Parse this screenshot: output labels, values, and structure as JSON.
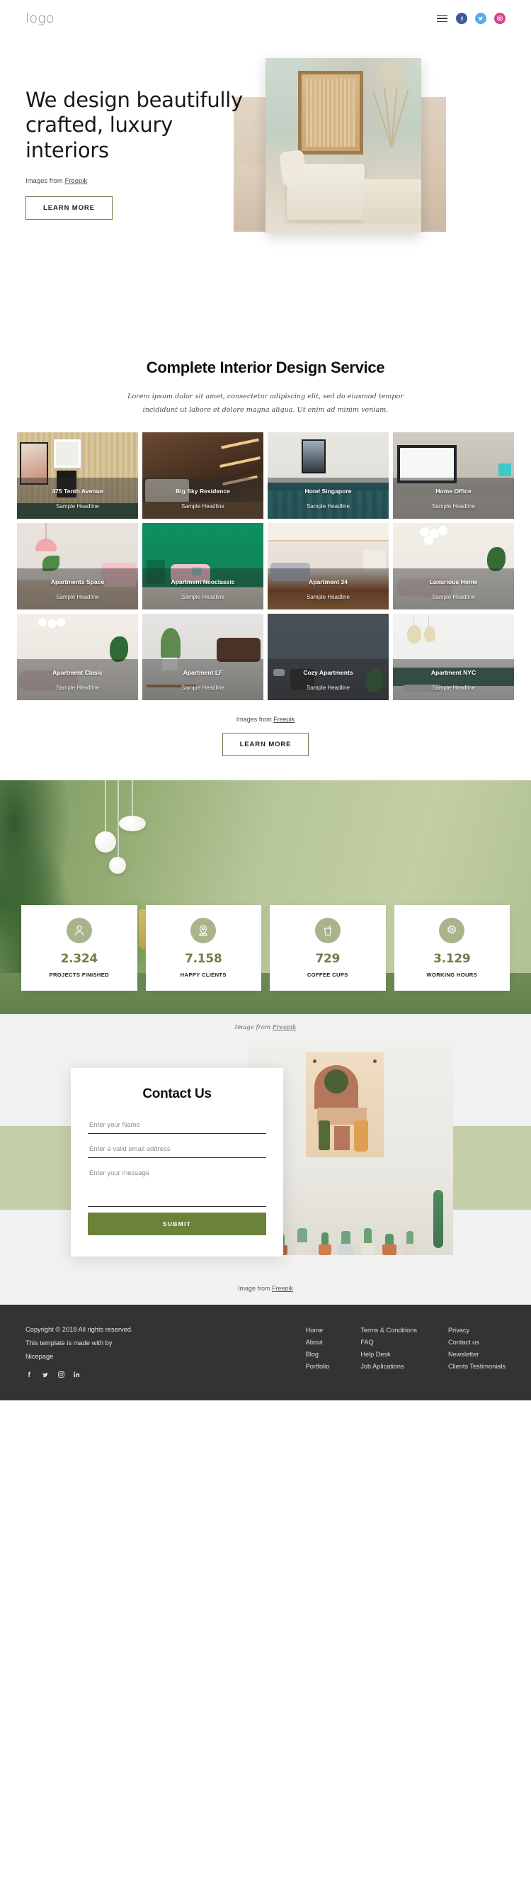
{
  "header": {
    "logo": "logo",
    "menu_icon": "hamburger-icon",
    "social": [
      {
        "name": "facebook-icon",
        "label": "f"
      },
      {
        "name": "twitter-icon",
        "label": "t"
      },
      {
        "name": "instagram-icon",
        "label": "i"
      }
    ]
  },
  "hero": {
    "title": "We design beautifully crafted, luxury interiors",
    "credit_prefix": "Images from ",
    "credit_link": "Freepik",
    "cta": "LEARN MORE"
  },
  "service": {
    "title": "Complete Interior Design Service",
    "subtitle": "Lorem ipsum dolor sit amet, consectetur adipiscing elit, sed do eiusmod tempor incididunt ut labore et dolore magna aliqua. Ut enim ad minim veniam.",
    "credit_prefix": "Images from ",
    "credit_link": "Freepik",
    "cta": "LEARN MORE",
    "cards": [
      {
        "title": "475 Tenth Avenue",
        "sub": "Sample Headline"
      },
      {
        "title": "Big Sky Residence",
        "sub": "Sample Headline"
      },
      {
        "title": "Hotel Singapore",
        "sub": "Sample Headline"
      },
      {
        "title": "Home Office",
        "sub": "Sample Headline"
      },
      {
        "title": "Apartments Space",
        "sub": "Sample Headline"
      },
      {
        "title": "Apartment Neoclassic",
        "sub": "Sample Headline"
      },
      {
        "title": "Apartment 34",
        "sub": "Sample Headline"
      },
      {
        "title": "Luxurious Home",
        "sub": "Sample Headline"
      },
      {
        "title": "Apartment Clasic",
        "sub": "Sample Headline"
      },
      {
        "title": "Apartment LF",
        "sub": "Sample Headline"
      },
      {
        "title": "Cozy Apartments",
        "sub": "Sample Headline"
      },
      {
        "title": "Apartment NYC",
        "sub": "Sample Headline"
      }
    ]
  },
  "stats": {
    "items": [
      {
        "icon": "user-icon",
        "value": "2.324",
        "label": "PROJECTS FINISHED"
      },
      {
        "icon": "map-pin-icon",
        "value": "7.158",
        "label": "HAPPY CLIENTS"
      },
      {
        "icon": "coffee-cup-icon",
        "value": "729",
        "label": "COFFEE CUPS"
      },
      {
        "icon": "gear-icon",
        "value": "3.129",
        "label": "WORKING HOURS"
      }
    ],
    "credit_prefix": "Image from ",
    "credit_link": "Freepik"
  },
  "contact": {
    "title": "Contact Us",
    "name_placeholder": "Enter your Name",
    "email_placeholder": "Enter a valid email address",
    "message_placeholder": "Enter your message",
    "submit": "SUBMIT",
    "credit_prefix": "Image from ",
    "credit_link": "Freepik"
  },
  "footer": {
    "copyright": "Copyright © 2018 All rights reserved.",
    "made_with": "This template is made with by",
    "brand": "Nicepage",
    "social": [
      {
        "name": "facebook-icon"
      },
      {
        "name": "twitter-icon"
      },
      {
        "name": "instagram-icon"
      },
      {
        "name": "linkedin-icon"
      }
    ],
    "columns": [
      {
        "links": [
          "Home",
          "About",
          "Blog",
          "Portfolio"
        ]
      },
      {
        "links": [
          "Terms & Conditions",
          "FAQ",
          "Help Desk",
          "Job Aplications"
        ]
      },
      {
        "links": [
          "Privacy",
          "Contact us",
          "Newsletter",
          "Clients Testimonials"
        ]
      }
    ]
  },
  "colors": {
    "accent_green": "#6b8239",
    "sage": "#a9b48d",
    "band": "#c4cfa9",
    "footer_bg": "#333333",
    "stat_number": "#6d7f46"
  }
}
